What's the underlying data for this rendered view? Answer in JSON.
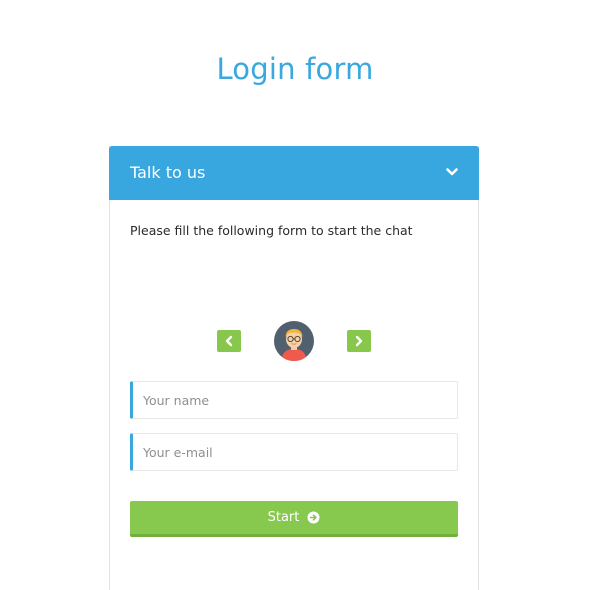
{
  "page": {
    "title": "Login form"
  },
  "panel": {
    "title": "Talk to us",
    "intro": "Please fill the following form to start the chat"
  },
  "avatar_picker": {
    "prev_icon": "chevron-left-icon",
    "next_icon": "chevron-right-icon"
  },
  "form": {
    "name_placeholder": "Your name",
    "name_value": "",
    "email_placeholder": "Your e-mail",
    "email_value": "",
    "start_label": "Start"
  },
  "colors": {
    "accent": "#38a7e0",
    "button_green": "#87c94e"
  }
}
